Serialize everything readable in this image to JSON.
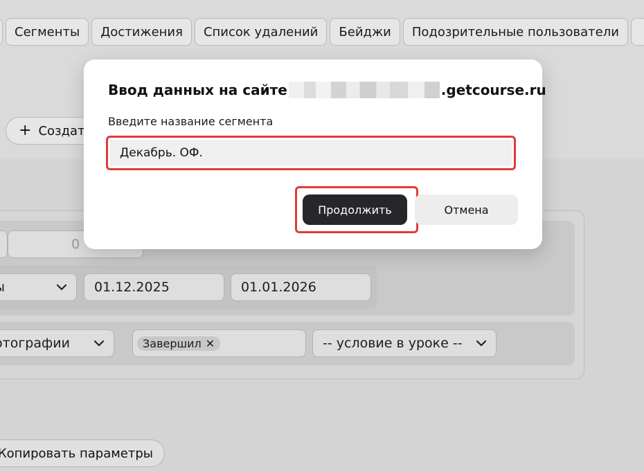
{
  "tabs": [
    "",
    "Сегменты",
    "Достижения",
    "Список удалений",
    "Бейджи",
    "Подозрительные пользователи",
    ""
  ],
  "create_button": {
    "label": "Создать"
  },
  "filters": {
    "row1": {
      "number_value": "0"
    },
    "row2": {
      "select_value": "ы",
      "date_from": "01.12.2025",
      "date_to": "01.01.2026"
    },
    "row3": {
      "select_value": "отографии",
      "chip_label": "Завершил",
      "condition_select": "-- условие в уроке --"
    }
  },
  "copy_button": {
    "label": "Копировать параметры"
  },
  "dialog": {
    "title_prefix": "Ввод данных на сайте",
    "title_suffix": ".getcourse.ru",
    "label": "Введите название сегмента",
    "input_value": "Декабрь. ОФ.",
    "continue_label": "Продолжить",
    "cancel_label": "Отмена",
    "highlight_color": "#e03a3a"
  },
  "icons": {
    "plus": "+",
    "chip_close": "✕"
  }
}
